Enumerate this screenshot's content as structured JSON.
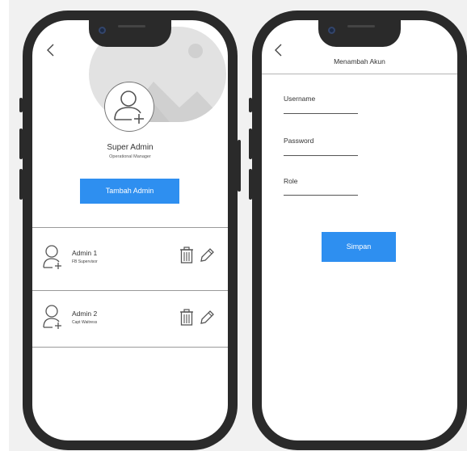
{
  "left_screen": {
    "back_icon": "chevron-left-icon",
    "profile": {
      "name": "Super Admin",
      "role": "Operational Manager"
    },
    "add_admin_label": "Tambah Admin",
    "admins": [
      {
        "name": "Admin 1",
        "role": "FB Supervisor"
      },
      {
        "name": "Admin 2",
        "role": "Capt Waitress"
      }
    ],
    "row_icons": [
      "trash-icon",
      "pencil-icon"
    ]
  },
  "right_screen": {
    "back_icon": "chevron-left-icon",
    "title": "Menambah Akun",
    "fields": [
      {
        "label": "Username"
      },
      {
        "label": "Password"
      },
      {
        "label": "Role"
      }
    ],
    "save_label": "Simpan"
  },
  "colors": {
    "primary": "#2e8ff0",
    "frame": "#2a2a2a",
    "placeholder": "#e2e2e2"
  }
}
